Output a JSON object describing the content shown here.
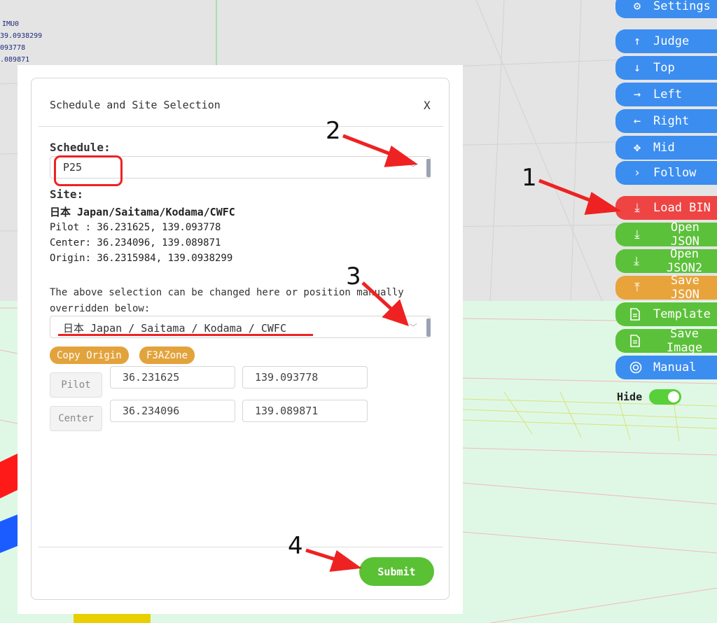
{
  "imu": {
    "label": "IMU0",
    "lines": [
      "39.0938299",
      "093778",
      ".089871"
    ]
  },
  "menu": {
    "settings": "Settings",
    "judge": "Judge",
    "top": "Top",
    "left": "Left",
    "right": "Right",
    "mid": "Mid",
    "follow": "Follow",
    "load_bin": "Load BIN",
    "open_json": "Open JSON",
    "open_json2": "Open JSON2",
    "save_json": "Save JSON",
    "template": "Template",
    "save_image": "Save Image",
    "manual": "Manual",
    "hide_label": "Hide",
    "hide_on": true
  },
  "modal": {
    "title": "Schedule and Site Selection",
    "close": "X",
    "schedule_label": "Schedule:",
    "schedule_value": "P25",
    "site_label": "Site:",
    "site_name": "日本 Japan/Saitama/Kodama/CWFC",
    "pilot_line": "Pilot : 36.231625, 139.093778",
    "center_line": "Center: 36.234096, 139.089871",
    "origin_line": "Origin: 36.2315984, 139.0938299",
    "hint": "The above selection can be changed here or position manually overridden below:",
    "site_select_value": "日本 Japan / Saitama / Kodama / CWFC",
    "copy_origin": "Copy Origin",
    "f3azone": "F3AZone",
    "pilot_btn": "Pilot",
    "pilot_lat": "36.231625",
    "pilot_lon": "139.093778",
    "center_btn": "Center",
    "center_lat": "36.234096",
    "center_lon": "139.089871",
    "submit": "Submit"
  },
  "annotations": {
    "n1": "1",
    "n2": "2",
    "n3": "3",
    "n4": "4",
    "arrow_color": "#ee2222"
  },
  "colors": {
    "blue": "#3b8df0",
    "red": "#ee4444",
    "green": "#5cc13a",
    "orange": "#e8a33a"
  }
}
